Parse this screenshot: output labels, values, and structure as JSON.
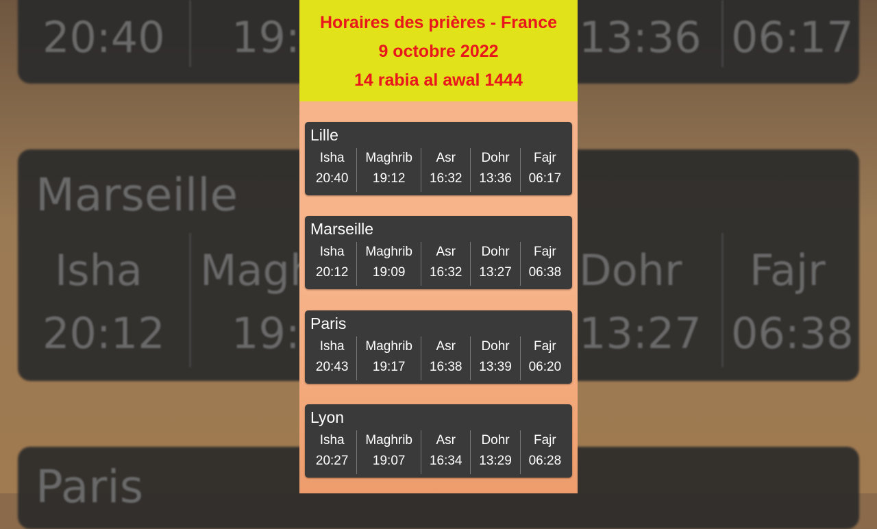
{
  "header": {
    "title": "Horaires des prières - France",
    "date_gregorian": "9 octobre 2022",
    "date_hijri": "14 rabia al awal 1444"
  },
  "prayer_labels": [
    "Isha",
    "Maghrib",
    "Asr",
    "Dohr",
    "Fajr"
  ],
  "cities": [
    {
      "name": "Lille",
      "times": [
        "20:40",
        "19:12",
        "16:32",
        "13:36",
        "06:17"
      ]
    },
    {
      "name": "Marseille",
      "times": [
        "20:12",
        "19:09",
        "16:32",
        "13:27",
        "06:38"
      ]
    },
    {
      "name": "Paris",
      "times": [
        "20:43",
        "19:17",
        "16:38",
        "13:39",
        "06:20"
      ]
    },
    {
      "name": "Lyon",
      "times": [
        "20:27",
        "19:07",
        "16:34",
        "13:29",
        "06:28"
      ]
    }
  ],
  "background_mirror": {
    "top_left_time": "20:40",
    "top_mid_time": "19:1",
    "top_right_time_1": "13:36",
    "top_right_time_2": "06:17",
    "city": "Marseille",
    "isha_label": "Isha",
    "maghrib_label": "Magh",
    "dohr_label": "Dohr",
    "fajr_label": "Fajr",
    "isha_time": "20:12",
    "maghrib_time": "19:0",
    "dohr_time": "13:27",
    "fajr_time": "06:38",
    "bottom_city": "Paris"
  },
  "colors": {
    "header_bg": "#e2e21b",
    "header_text": "#e8171c",
    "panel_bg": "#f7b48a",
    "card_bg": "#3a3a3a",
    "card_text": "#ffffff"
  }
}
